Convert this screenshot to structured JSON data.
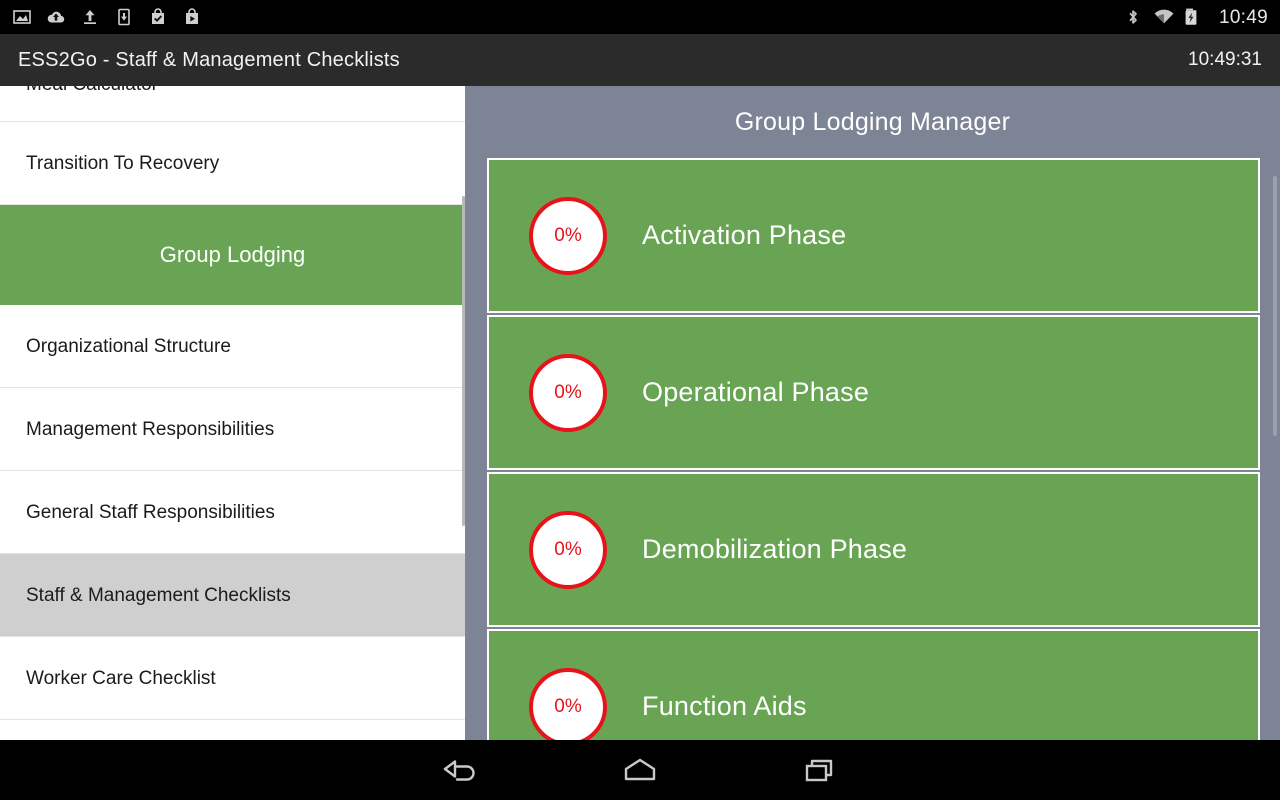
{
  "statusbar": {
    "left_icons": [
      {
        "name": "screenshot-icon"
      },
      {
        "name": "cloud-upload-icon"
      },
      {
        "name": "upload-arrow-icon"
      },
      {
        "name": "download-to-device-icon"
      },
      {
        "name": "shopping-bag-check-icon"
      },
      {
        "name": "play-store-bag-icon"
      }
    ],
    "right_icons": [
      {
        "name": "bluetooth-icon"
      },
      {
        "name": "wifi-icon"
      },
      {
        "name": "battery-charging-icon"
      }
    ],
    "clock": "10:49"
  },
  "appbar": {
    "title": "ESS2Go - Staff & Management Checklists",
    "clock": "10:49:31"
  },
  "sidebar": {
    "items": [
      {
        "label": "Meal Calculator",
        "state": "partial"
      },
      {
        "label": "Transition To Recovery",
        "state": "normal"
      },
      {
        "label": "Group Lodging",
        "state": "active-green"
      },
      {
        "label": "Organizational Structure",
        "state": "normal"
      },
      {
        "label": "Management Responsibilities",
        "state": "normal"
      },
      {
        "label": "General Staff Responsibilities",
        "state": "normal"
      },
      {
        "label": "Staff & Management Checklists",
        "state": "selected"
      },
      {
        "label": "Worker Care Checklist",
        "state": "normal"
      }
    ]
  },
  "panel": {
    "title": "Group Lodging Manager",
    "cards": [
      {
        "percent": "0%",
        "label": "Activation Phase"
      },
      {
        "percent": "0%",
        "label": "Operational Phase"
      },
      {
        "percent": "0%",
        "label": "Demobilization Phase"
      },
      {
        "percent": "0%",
        "label": "Function Aids"
      }
    ]
  },
  "navbar": {
    "buttons": [
      {
        "name": "back-icon",
        "label": "Back"
      },
      {
        "name": "home-icon",
        "label": "Home"
      },
      {
        "name": "recents-icon",
        "label": "Recent apps"
      }
    ]
  },
  "colors": {
    "green": "#68a453",
    "panel_bg": "#7d8496",
    "red": "#e8121a",
    "appbar_bg": "#2b2b2b",
    "selected_bg": "#cfcfcf"
  }
}
